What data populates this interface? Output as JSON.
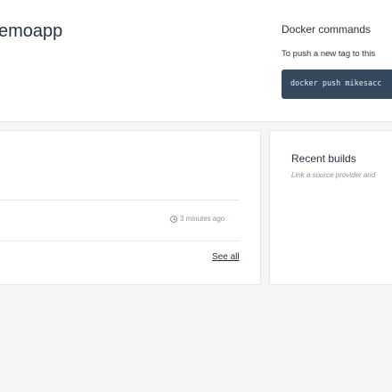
{
  "repository": {
    "name_visible": "emoapp"
  },
  "docker_commands": {
    "title": "Docker commands",
    "description": "To push a new tag to this",
    "command": "docker push mikesacc"
  },
  "tags_card": {
    "rows": [
      {
        "time": "3 minutes ago"
      }
    ],
    "see_all_label": "See all"
  },
  "recent_builds": {
    "title": "Recent builds",
    "description": "Link a source provider and"
  },
  "icons": {
    "time": "clock-icon"
  }
}
